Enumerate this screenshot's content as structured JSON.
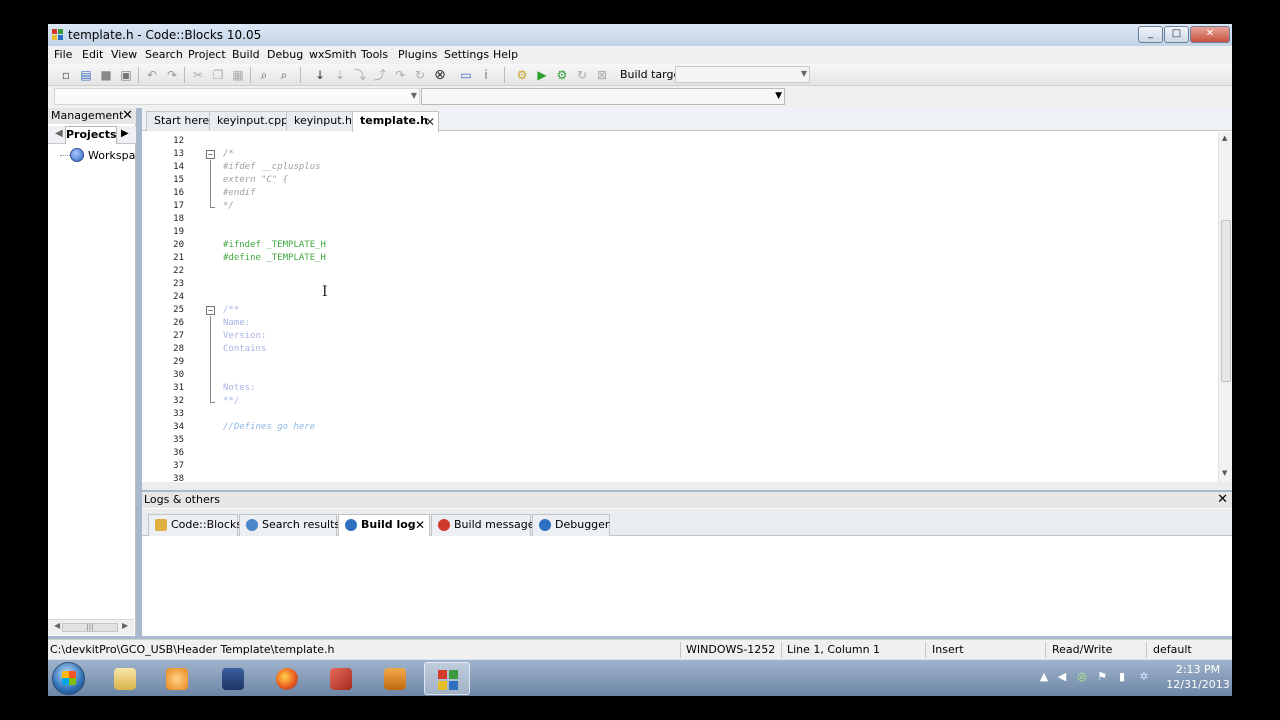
{
  "window": {
    "title": "template.h - Code::Blocks 10.05",
    "min_label": "_",
    "max_label": "□",
    "close_label": "✕"
  },
  "menu": [
    "File",
    "Edit",
    "View",
    "Search",
    "Project",
    "Build",
    "Debug",
    "wxSmith",
    "Tools",
    "Plugins",
    "Settings",
    "Help"
  ],
  "toolbar": {
    "build_target_label": "Build target:",
    "build_target_value": "",
    "icons": [
      "new-file-icon",
      "open-icon",
      "save-icon",
      "save-all-icon",
      "undo-icon",
      "redo-icon",
      "cut-icon",
      "copy-icon",
      "paste-icon",
      "find-icon",
      "replace-icon",
      "jump-icon",
      "step-icon",
      "step-into-icon",
      "step-out-icon",
      "next-icon",
      "continue-icon",
      "stop-debug-icon",
      "debug-window-icon",
      "info-icon",
      "build-icon",
      "run-icon",
      "build-run-icon",
      "rebuild-icon",
      "abort-icon"
    ]
  },
  "code_completion": {
    "scope_value": "",
    "symbol_value": ""
  },
  "management": {
    "title": "Management",
    "close_label": "✕",
    "tab": "Projects",
    "tree_root": "Workspace",
    "scroll_thumb": "|||"
  },
  "editor": {
    "tabs": [
      {
        "label": "Start here",
        "active": false
      },
      {
        "label": "keyinput.cpp",
        "active": false
      },
      {
        "label": "keyinput.h",
        "active": false
      },
      {
        "label": "template.h",
        "active": true
      }
    ],
    "tab_close": "✕",
    "lines": [
      {
        "n": "12",
        "text": "",
        "style": "plain"
      },
      {
        "n": "13",
        "text": "/*",
        "style": "comment"
      },
      {
        "n": "14",
        "text": "#ifdef __cplusplus",
        "style": "comment"
      },
      {
        "n": "15",
        "text": "extern \"C\" {",
        "style": "comment"
      },
      {
        "n": "16",
        "text": "#endif",
        "style": "comment"
      },
      {
        "n": "17",
        "text": "*/",
        "style": "comment"
      },
      {
        "n": "18",
        "text": "",
        "style": "plain"
      },
      {
        "n": "19",
        "text": "",
        "style": "plain"
      },
      {
        "n": "20",
        "text": "#ifndef _TEMPLATE_H",
        "style": "pre"
      },
      {
        "n": "21",
        "text": "#define _TEMPLATE_H",
        "style": "pre"
      },
      {
        "n": "22",
        "text": "",
        "style": "plain"
      },
      {
        "n": "23",
        "text": "",
        "style": "plain"
      },
      {
        "n": "24",
        "text": "",
        "style": "plain"
      },
      {
        "n": "25",
        "text": "/**",
        "style": "doc"
      },
      {
        "n": "26",
        "text": "Name:",
        "style": "doc"
      },
      {
        "n": "27",
        "text": "Version:",
        "style": "doc"
      },
      {
        "n": "28",
        "text": "Contains",
        "style": "doc"
      },
      {
        "n": "29",
        "text": "",
        "style": "plain"
      },
      {
        "n": "30",
        "text": "",
        "style": "plain"
      },
      {
        "n": "31",
        "text": "Notes:",
        "style": "doc"
      },
      {
        "n": "32",
        "text": "**/",
        "style": "doc"
      },
      {
        "n": "33",
        "text": "",
        "style": "plain"
      },
      {
        "n": "34",
        "text": "//Defines go here",
        "style": "cpp"
      },
      {
        "n": "35",
        "text": "",
        "style": "plain"
      },
      {
        "n": "36",
        "text": "",
        "style": "plain"
      },
      {
        "n": "37",
        "text": "",
        "style": "plain"
      },
      {
        "n": "38",
        "text": "",
        "style": "plain"
      }
    ]
  },
  "logs": {
    "title": "Logs & others",
    "close_label": "✕",
    "tabs": [
      {
        "label": "Code::Blocks",
        "active": false,
        "icon": "document-edit-icon",
        "color": "#e0b040"
      },
      {
        "label": "Search results",
        "active": false,
        "icon": "search-icon",
        "color": "#4a86c8"
      },
      {
        "label": "Build log",
        "active": true,
        "icon": "gear-icon",
        "color": "#2f6fc0"
      },
      {
        "label": "Build messages",
        "active": false,
        "icon": "pin-icon",
        "color": "#d03a2a"
      },
      {
        "label": "Debugger",
        "active": false,
        "icon": "bug-icon",
        "color": "#2f6fc0"
      }
    ],
    "tab_close": "✕"
  },
  "status": {
    "path": "C:\\devkitPro\\GCO_USB\\Header Template\\template.h",
    "encoding": "WINDOWS-1252",
    "position": "Line 1, Column 1",
    "mode": "Insert",
    "access": "Read/Write",
    "profile": "default"
  },
  "taskbar": {
    "time": "2:13 PM",
    "date": "12/31/2013",
    "apps": [
      "file-explorer-icon",
      "media-player-icon",
      "checkmark-app-icon",
      "firefox-icon",
      "codeblocks-red-icon",
      "media-icon",
      "codeblocks-icon"
    ]
  },
  "colors": {
    "preprocessor": "#3ea83e",
    "comment": "#a0a0a0",
    "doc_comment": "#a7b3e6",
    "line_comment": "#8db8e6"
  }
}
